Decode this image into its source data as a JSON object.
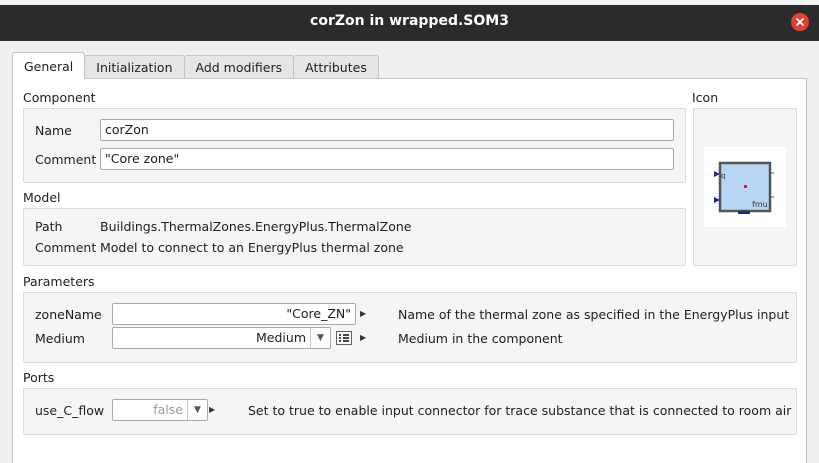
{
  "window": {
    "title": "corZon in wrapped.SOM3",
    "close_icon": "close-icon"
  },
  "tabs": [
    {
      "label": "General"
    },
    {
      "label": "Initialization"
    },
    {
      "label": "Add modifiers"
    },
    {
      "label": "Attributes"
    }
  ],
  "component": {
    "section_label": "Component",
    "name_label": "Name",
    "name_value": "corZon",
    "comment_label": "Comment",
    "comment_value": "\"Core zone\""
  },
  "icon_section": {
    "label": "Icon",
    "port_label": "fmu",
    "corner_label": "q"
  },
  "model": {
    "section_label": "Model",
    "path_label": "Path",
    "path_value": "Buildings.ThermalZones.EnergyPlus.ThermalZone",
    "comment_label": "Comment",
    "comment_value": "Model to connect to an EnergyPlus thermal zone"
  },
  "parameters": {
    "section_label": "Parameters",
    "rows": [
      {
        "name": "zoneName",
        "value": "\"Core_ZN\"",
        "description": "Name of the thermal zone as specified in the EnergyPlus input"
      },
      {
        "name": "Medium",
        "value": "Medium",
        "description": "Medium in the component"
      }
    ]
  },
  "ports": {
    "section_label": "Ports",
    "rows": [
      {
        "name": "use_C_flow",
        "value": "false",
        "description": "Set to true to enable input connector for trace substance that is connected to room air"
      }
    ]
  },
  "colors": {
    "titlebar": "#2b2b2b",
    "close": "#e0402f",
    "icon_fill": "#b7d6f5",
    "icon_port": "#1f2d8a"
  }
}
